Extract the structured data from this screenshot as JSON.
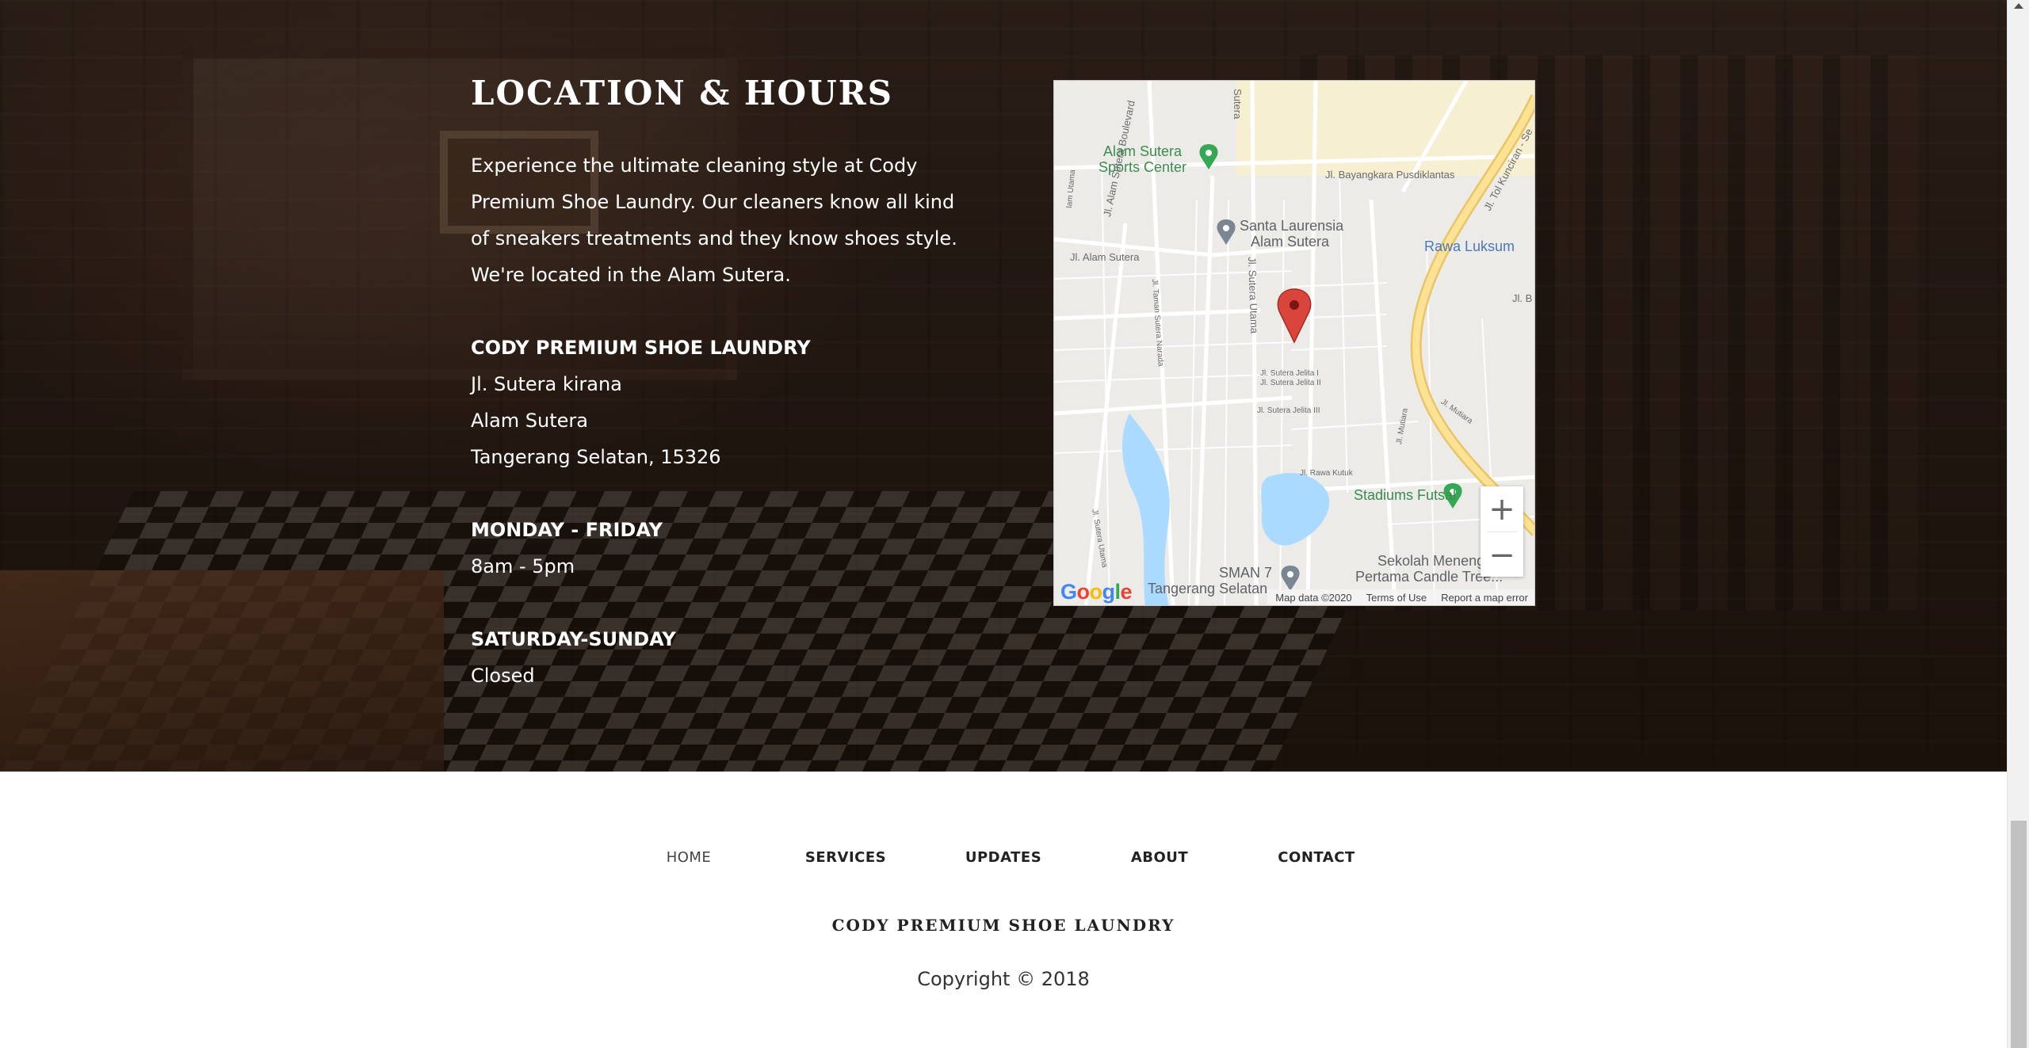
{
  "location": {
    "title": "LOCATION & HOURS",
    "intro": "Experience the ultimate cleaning style at Cody Premium Shoe Laundry. Our cleaners know all kind of sneakers treatments and they know shoes style. We're located in the Alam Sutera.",
    "address": {
      "name": "CODY PREMIUM SHOE LAUNDRY",
      "line1": "Jl. Sutera kirana",
      "line2": "Alam Sutera",
      "line3": "Tangerang Selatan, 15326"
    },
    "weekday": {
      "label": "MONDAY - FRIDAY",
      "hours": "8am - 5pm"
    },
    "weekend": {
      "label": "SATURDAY-SUNDAY",
      "hours": "Closed"
    }
  },
  "map": {
    "labels": {
      "alam_sutera_sports_1": "Alam Sutera",
      "alam_sutera_sports_2": "Sports Center",
      "santa_laurensia_1": "Santa Laurensia",
      "santa_laurensia_2": "Alam Sutera",
      "rawa_luksum": "Rawa Luksum",
      "stadiums_futsal": "Stadiums Futsal",
      "sekolah_1": "Sekolah Menenga",
      "sekolah_2": "Pertama Candle Tree...",
      "sman7": "SMAN 7",
      "tangerang_selatan": "Tangerang Selatan",
      "jl_bayangkara": "Jl. Bayangkara Pusdiklantas",
      "jl_alam_sutera": "Jl. Alam Sutera",
      "jl_alam_sutera_blvd": "Jl. Alam Sutera Boulevard",
      "jl_tol_kunciran": "Jl. Tol Kunciran - Se",
      "jl_sutera_utama": "Jl. Sutera Utama",
      "jl_sutera_jelita_1": "Jl. Sutera Jelita I",
      "jl_sutera_jelita_2": "Jl. Sutera Jelita II",
      "jl_sutera_jelita_3": "Jl. Sutera Jelita III",
      "jl_mutiara": "Jl. Mutiara",
      "jl_rawa_kutuk": "Jl. Rawa Kutuk",
      "jl_b": "Jl. B",
      "sutera": "Sutera",
      "utama": "lam Utama",
      "jl_sutera_narada": "Jl. Taman Sutera Narada",
      "jl_sutera_ru": "Jl. Sutera Utama"
    },
    "zoom_in": "+",
    "zoom_out": "−",
    "google": [
      "G",
      "o",
      "o",
      "g",
      "l",
      "e"
    ],
    "attribution": {
      "data": "Map data ©2020",
      "terms": "Terms of Use",
      "report": "Report a map error"
    },
    "colors": {
      "marker": "#d9453b",
      "water": "#aadaff",
      "highway": "#fde293",
      "park_pin": "#34a853"
    }
  },
  "footer": {
    "nav": {
      "home": "HOME",
      "services": "SERVICES",
      "updates": "UPDATES",
      "about": "ABOUT",
      "contact": "CONTACT"
    },
    "brand": "CODY PREMIUM SHOE LAUNDRY",
    "copyright": "Copyright © 2018"
  }
}
